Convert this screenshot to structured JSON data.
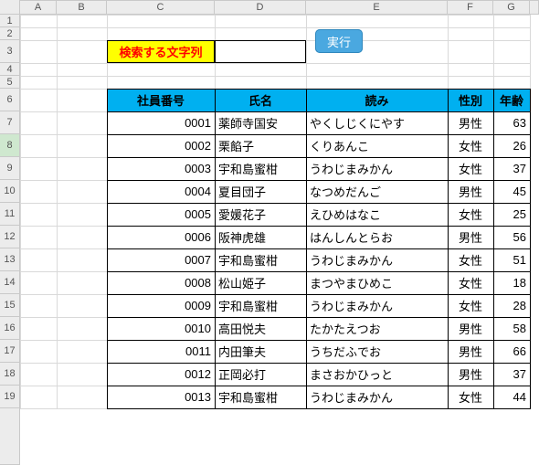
{
  "columns": {
    "labels": [
      "A",
      "B",
      "C",
      "D",
      "E",
      "F",
      "G"
    ],
    "widths": [
      40,
      55,
      118,
      100,
      155,
      50,
      40
    ]
  },
  "rows": {
    "count": 19,
    "heights": {
      "1": 14,
      "2": 14,
      "3": 25,
      "4": 14,
      "5": 14,
      "6": 25,
      "7": 25,
      "8": 25,
      "9": 25,
      "10": 25,
      "11": 25,
      "12": 25,
      "13": 25,
      "14": 25,
      "15": 25,
      "16": 25,
      "17": 25,
      "18": 25,
      "19": 25
    },
    "selected": 8
  },
  "search": {
    "label": "検索する文字列",
    "value": ""
  },
  "exec_button": {
    "label": "実行"
  },
  "table": {
    "headers": {
      "id": "社員番号",
      "name": "氏名",
      "reading": "読み",
      "gender": "性別",
      "age": "年齢"
    },
    "rows": [
      {
        "id": "0001",
        "name": "薬師寺国安",
        "reading": "やくしじくにやす",
        "gender": "男性",
        "age": 63
      },
      {
        "id": "0002",
        "name": "栗餡子",
        "reading": "くりあんこ",
        "gender": "女性",
        "age": 26
      },
      {
        "id": "0003",
        "name": "宇和島蜜柑",
        "reading": "うわじまみかん",
        "gender": "女性",
        "age": 37
      },
      {
        "id": "0004",
        "name": "夏目団子",
        "reading": "なつめだんご",
        "gender": "男性",
        "age": 45
      },
      {
        "id": "0005",
        "name": "愛媛花子",
        "reading": "えひめはなこ",
        "gender": "女性",
        "age": 25
      },
      {
        "id": "0006",
        "name": "阪神虎雄",
        "reading": "はんしんとらお",
        "gender": "男性",
        "age": 56
      },
      {
        "id": "0007",
        "name": "宇和島蜜柑",
        "reading": "うわじまみかん",
        "gender": "女性",
        "age": 51
      },
      {
        "id": "0008",
        "name": "松山姫子",
        "reading": "まつやまひめこ",
        "gender": "女性",
        "age": 18
      },
      {
        "id": "0009",
        "name": "宇和島蜜柑",
        "reading": "うわじまみかん",
        "gender": "女性",
        "age": 28
      },
      {
        "id": "0010",
        "name": "高田悦夫",
        "reading": "たかたえつお",
        "gender": "男性",
        "age": 58
      },
      {
        "id": "0011",
        "name": "内田筆夫",
        "reading": "うちだふでお",
        "gender": "男性",
        "age": 66
      },
      {
        "id": "0012",
        "name": "正岡必打",
        "reading": "まさおかひっと",
        "gender": "男性",
        "age": 37
      },
      {
        "id": "0013",
        "name": "宇和島蜜柑",
        "reading": "うわじまみかん",
        "gender": "女性",
        "age": 44
      }
    ]
  }
}
